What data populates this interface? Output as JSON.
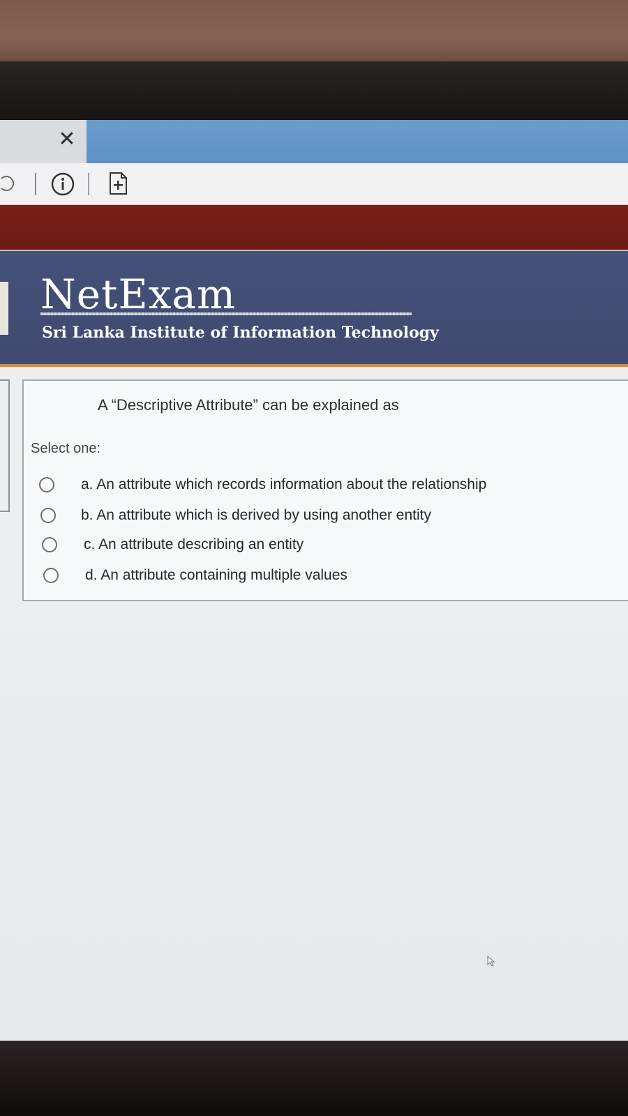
{
  "browser": {
    "tab_close_glyph": "✕",
    "icons": [
      "refresh-icon",
      "info-icon",
      "page-add-icon",
      "close-icon"
    ]
  },
  "header": {
    "logo": "NetExam",
    "institute": "Sri Lanka Institute of Information Technology"
  },
  "quiz": {
    "question": "A “Descriptive Attribute” can be explained as",
    "select_label": "Select one:",
    "options": [
      {
        "label": "a. An attribute which records information about the relationship"
      },
      {
        "label": "b. An attribute which is derived by using another entity"
      },
      {
        "label": "c. An attribute describing an entity"
      },
      {
        "label": "d. An attribute containing multiple values"
      }
    ]
  },
  "colors": {
    "tab_active": "#5d92c4",
    "red_bar": "#731d18",
    "banner": "#424d74",
    "orange_rule": "#e0893a"
  }
}
